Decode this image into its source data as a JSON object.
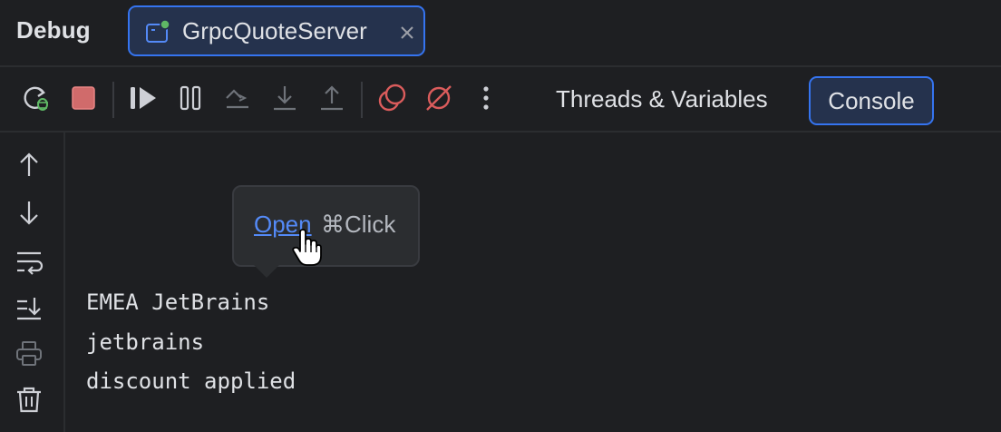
{
  "header": {
    "title": "Debug",
    "tab": {
      "label": "GrpcQuoteServer",
      "icon": "run-config-icon",
      "status_dot_color": "#5fb865"
    }
  },
  "toolbar": {
    "buttons": [
      {
        "name": "rerun-debug-icon"
      },
      {
        "name": "stop-icon"
      },
      {
        "name": "resume-icon"
      },
      {
        "name": "pause-icon"
      },
      {
        "name": "step-over-icon"
      },
      {
        "name": "step-into-icon"
      },
      {
        "name": "step-out-icon"
      },
      {
        "name": "view-breakpoints-icon"
      },
      {
        "name": "mute-breakpoints-icon"
      },
      {
        "name": "more-options-icon"
      }
    ],
    "views": {
      "threads_label": "Threads & Variables",
      "console_label": "Console"
    }
  },
  "sidebar": {
    "buttons": [
      {
        "name": "scroll-up-icon"
      },
      {
        "name": "scroll-down-icon"
      },
      {
        "name": "soft-wrap-icon"
      },
      {
        "name": "scroll-to-end-icon"
      },
      {
        "name": "print-icon"
      },
      {
        "name": "clear-all-icon"
      }
    ]
  },
  "console": {
    "lines": [
      "EMEA JetBrains",
      "jetbrains",
      "discount applied"
    ]
  },
  "tooltip": {
    "link_label": "Open",
    "shortcut": "⌘Click"
  },
  "colors": {
    "background": "#1e1f22",
    "accent": "#3574f0",
    "selected_bg": "#25324d",
    "stop_red": "#db5c5c",
    "link_blue": "#548af7",
    "bug_green": "#5fb865"
  }
}
